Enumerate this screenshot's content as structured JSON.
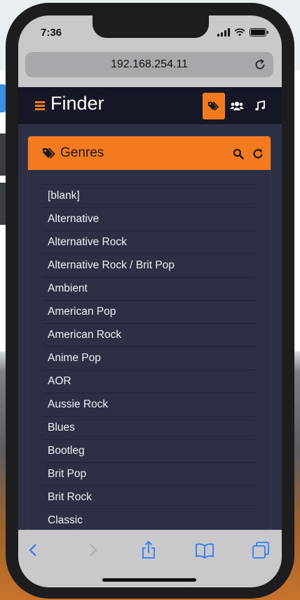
{
  "status": {
    "time": "7:36"
  },
  "browser": {
    "url": "192.168.254.11"
  },
  "app": {
    "title": "Finder"
  },
  "panel": {
    "title": "Genres",
    "genres": [
      "[blank]",
      "Alternative",
      "Alternative Rock",
      "Alternative Rock / Brit Pop",
      "Ambient",
      "American Pop",
      "American Rock",
      "Anime Pop",
      "AOR",
      "Aussie Rock",
      "Blues",
      "Bootleg",
      "Brit Pop",
      "Brit Rock",
      "Classic"
    ]
  },
  "colors": {
    "accent": "#f47a20",
    "header_bg": "#161726",
    "panel_bg": "#2d2f45",
    "ios_blue": "#2f7cf6"
  },
  "icons": {
    "menu": "hamburger-icon",
    "tags": "tags-icon",
    "users": "users-icon",
    "music": "music-icon",
    "search": "search-icon",
    "refresh": "refresh-icon",
    "back": "back-icon",
    "forward": "forward-icon",
    "share": "share-icon",
    "bookmarks": "bookmarks-icon",
    "tabs": "tabs-icon"
  }
}
